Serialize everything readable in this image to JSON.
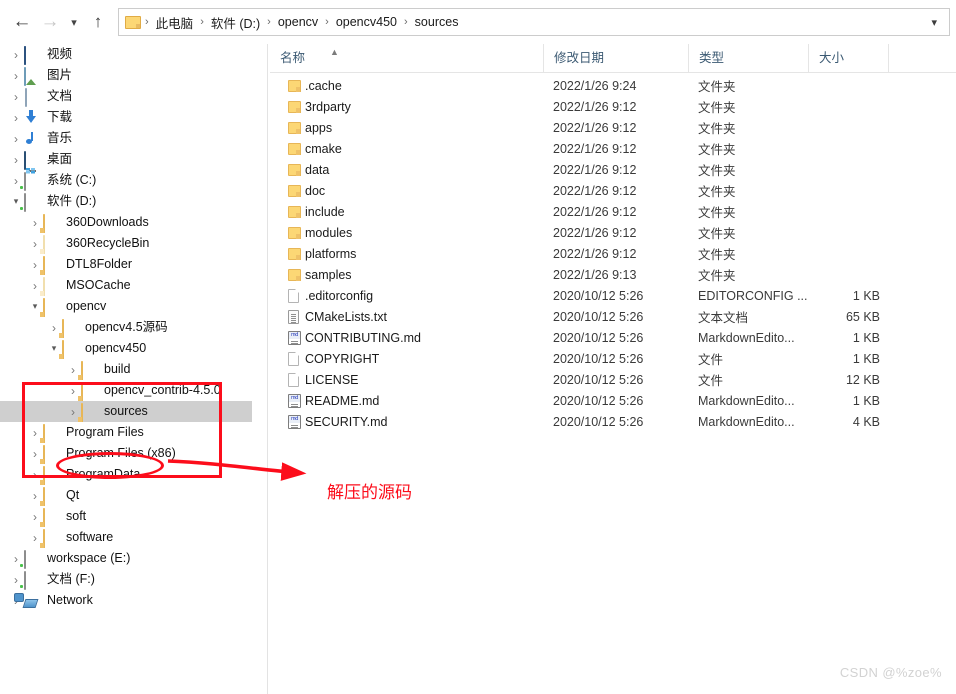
{
  "nav": {
    "back_icon": "arrow-left-icon",
    "forward_icon": "arrow-right-icon",
    "history_icon": "chevron-down-icon",
    "up_icon": "arrow-up-icon",
    "address_chevron": "chevron-down-icon",
    "breadcrumbs": [
      "此电脑",
      "软件 (D:)",
      "opencv",
      "opencv450",
      "sources"
    ],
    "separator": "›"
  },
  "sidebar": {
    "items": [
      {
        "label": "视频",
        "icon": "video-icon",
        "indent": 1,
        "twisty": "collapsed"
      },
      {
        "label": "图片",
        "icon": "picture-icon",
        "indent": 1,
        "twisty": "collapsed"
      },
      {
        "label": "文档",
        "icon": "document-icon",
        "indent": 1,
        "twisty": "collapsed"
      },
      {
        "label": "下载",
        "icon": "download-icon",
        "indent": 1,
        "twisty": "collapsed"
      },
      {
        "label": "音乐",
        "icon": "music-icon",
        "indent": 1,
        "twisty": "collapsed"
      },
      {
        "label": "桌面",
        "icon": "desktop-icon",
        "indent": 1,
        "twisty": "collapsed"
      },
      {
        "label": "系统 (C:)",
        "icon": "system-drive-icon",
        "indent": 1,
        "twisty": "collapsed"
      },
      {
        "label": "软件 (D:)",
        "icon": "drive-icon",
        "indent": 1,
        "twisty": "expanded"
      },
      {
        "label": "360Downloads",
        "icon": "folder-icon",
        "indent": 2,
        "twisty": "collapsed"
      },
      {
        "label": "360RecycleBin",
        "icon": "folder-faded-icon",
        "indent": 2,
        "twisty": "collapsed"
      },
      {
        "label": "DTL8Folder",
        "icon": "folder-icon",
        "indent": 2,
        "twisty": "collapsed"
      },
      {
        "label": "MSOCache",
        "icon": "folder-faded-icon",
        "indent": 2,
        "twisty": "collapsed"
      },
      {
        "label": "opencv",
        "icon": "folder-icon",
        "indent": 2,
        "twisty": "expanded"
      },
      {
        "label": "opencv4.5源码",
        "icon": "folder-icon",
        "indent": 3,
        "twisty": "collapsed"
      },
      {
        "label": "opencv450",
        "icon": "folder-icon",
        "indent": 3,
        "twisty": "expanded"
      },
      {
        "label": "build",
        "icon": "folder-icon",
        "indent": 4,
        "twisty": "collapsed"
      },
      {
        "label": "opencv_contrib-4.5.0",
        "icon": "folder-icon",
        "indent": 4,
        "twisty": "collapsed"
      },
      {
        "label": "sources",
        "icon": "folder-icon",
        "indent": 4,
        "twisty": "collapsed",
        "selected": true
      },
      {
        "label": "Program Files",
        "icon": "folder-icon",
        "indent": 2,
        "twisty": "collapsed"
      },
      {
        "label": "Program Files (x86)",
        "icon": "folder-icon",
        "indent": 2,
        "twisty": "collapsed"
      },
      {
        "label": "ProgramData",
        "icon": "folder-icon",
        "indent": 2,
        "twisty": "collapsed"
      },
      {
        "label": "Qt",
        "icon": "folder-icon",
        "indent": 2,
        "twisty": "collapsed"
      },
      {
        "label": "soft",
        "icon": "folder-icon",
        "indent": 2,
        "twisty": "collapsed"
      },
      {
        "label": "software",
        "icon": "folder-icon",
        "indent": 2,
        "twisty": "collapsed"
      },
      {
        "label": "workspace (E:)",
        "icon": "drive-icon",
        "indent": 1,
        "twisty": "collapsed"
      },
      {
        "label": "文档 (F:)",
        "icon": "drive-icon",
        "indent": 1,
        "twisty": "collapsed"
      },
      {
        "label": "Network",
        "icon": "network-icon",
        "indent": 1,
        "twisty": "collapsed"
      }
    ],
    "scroll_up_icon": "chevron-up-icon"
  },
  "filelist": {
    "columns": {
      "name": "名称",
      "date": "修改日期",
      "type": "类型",
      "size": "大小"
    },
    "sort_indicator_icon": "sort-ascending-caret-icon",
    "rows": [
      {
        "name": ".cache",
        "date": "2022/1/26 9:24",
        "type": "文件夹",
        "size": "",
        "icon": "folder-icon"
      },
      {
        "name": "3rdparty",
        "date": "2022/1/26 9:12",
        "type": "文件夹",
        "size": "",
        "icon": "folder-icon"
      },
      {
        "name": "apps",
        "date": "2022/1/26 9:12",
        "type": "文件夹",
        "size": "",
        "icon": "folder-icon"
      },
      {
        "name": "cmake",
        "date": "2022/1/26 9:12",
        "type": "文件夹",
        "size": "",
        "icon": "folder-icon"
      },
      {
        "name": "data",
        "date": "2022/1/26 9:12",
        "type": "文件夹",
        "size": "",
        "icon": "folder-icon"
      },
      {
        "name": "doc",
        "date": "2022/1/26 9:12",
        "type": "文件夹",
        "size": "",
        "icon": "folder-icon"
      },
      {
        "name": "include",
        "date": "2022/1/26 9:12",
        "type": "文件夹",
        "size": "",
        "icon": "folder-icon"
      },
      {
        "name": "modules",
        "date": "2022/1/26 9:12",
        "type": "文件夹",
        "size": "",
        "icon": "folder-icon"
      },
      {
        "name": "platforms",
        "date": "2022/1/26 9:12",
        "type": "文件夹",
        "size": "",
        "icon": "folder-icon"
      },
      {
        "name": "samples",
        "date": "2022/1/26 9:13",
        "type": "文件夹",
        "size": "",
        "icon": "folder-icon"
      },
      {
        "name": ".editorconfig",
        "date": "2020/10/12 5:26",
        "type": "EDITORCONFIG ...",
        "size": "1 KB",
        "icon": "blank-file-icon"
      },
      {
        "name": "CMakeLists.txt",
        "date": "2020/10/12 5:26",
        "type": "文本文档",
        "size": "65 KB",
        "icon": "text-file-icon"
      },
      {
        "name": "CONTRIBUTING.md",
        "date": "2020/10/12 5:26",
        "type": "MarkdownEdito...",
        "size": "1 KB",
        "icon": "markdown-file-icon"
      },
      {
        "name": "COPYRIGHT",
        "date": "2020/10/12 5:26",
        "type": "文件",
        "size": "1 KB",
        "icon": "blank-file-icon"
      },
      {
        "name": "LICENSE",
        "date": "2020/10/12 5:26",
        "type": "文件",
        "size": "12 KB",
        "icon": "blank-file-icon"
      },
      {
        "name": "README.md",
        "date": "2020/10/12 5:26",
        "type": "MarkdownEdito...",
        "size": "1 KB",
        "icon": "markdown-file-icon"
      },
      {
        "name": "SECURITY.md",
        "date": "2020/10/12 5:26",
        "type": "MarkdownEdito...",
        "size": "4 KB",
        "icon": "markdown-file-icon"
      }
    ],
    "markdown_badge": "md"
  },
  "annotation": {
    "callout_text": "解压的源码",
    "color": "#fc0d1b"
  },
  "watermark": {
    "text": "CSDN @%zoe%"
  }
}
